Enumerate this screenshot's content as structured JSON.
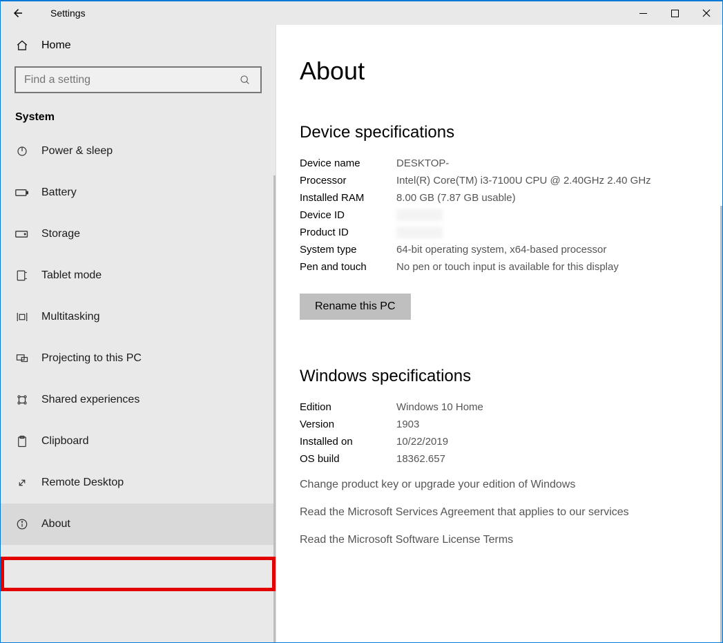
{
  "titlebar": {
    "title": "Settings"
  },
  "sidebar": {
    "home_label": "Home",
    "search_placeholder": "Find a setting",
    "category_label": "System",
    "items": [
      {
        "label": "Power & sleep"
      },
      {
        "label": "Battery"
      },
      {
        "label": "Storage"
      },
      {
        "label": "Tablet mode"
      },
      {
        "label": "Multitasking"
      },
      {
        "label": "Projecting to this PC"
      },
      {
        "label": "Shared experiences"
      },
      {
        "label": "Clipboard"
      },
      {
        "label": "Remote Desktop"
      },
      {
        "label": "About"
      }
    ]
  },
  "main": {
    "heading": "About",
    "device_section": "Device specifications",
    "device": {
      "device_name_k": "Device name",
      "device_name_v": "DESKTOP-",
      "processor_k": "Processor",
      "processor_v": "Intel(R) Core(TM) i3-7100U CPU @ 2.40GHz   2.40 GHz",
      "ram_k": "Installed RAM",
      "ram_v": "8.00 GB (7.87 GB usable)",
      "device_id_k": "Device ID",
      "device_id_v": "[redacted]",
      "product_id_k": "Product ID",
      "product_id_v": "[redacted]",
      "system_type_k": "System type",
      "system_type_v": "64-bit operating system, x64-based processor",
      "pen_k": "Pen and touch",
      "pen_v": "No pen or touch input is available for this display"
    },
    "rename_btn": "Rename this PC",
    "windows_section": "Windows specifications",
    "windows": {
      "edition_k": "Edition",
      "edition_v": "Windows 10 Home",
      "version_k": "Version",
      "version_v": "1903",
      "installed_on_k": "Installed on",
      "installed_on_v": "10/22/2019",
      "build_k": "OS build",
      "build_v": "18362.657"
    },
    "links": {
      "change_key": "Change product key or upgrade your edition of Windows",
      "msa": "Read the Microsoft Services Agreement that applies to our services",
      "license": "Read the Microsoft Software License Terms"
    }
  }
}
